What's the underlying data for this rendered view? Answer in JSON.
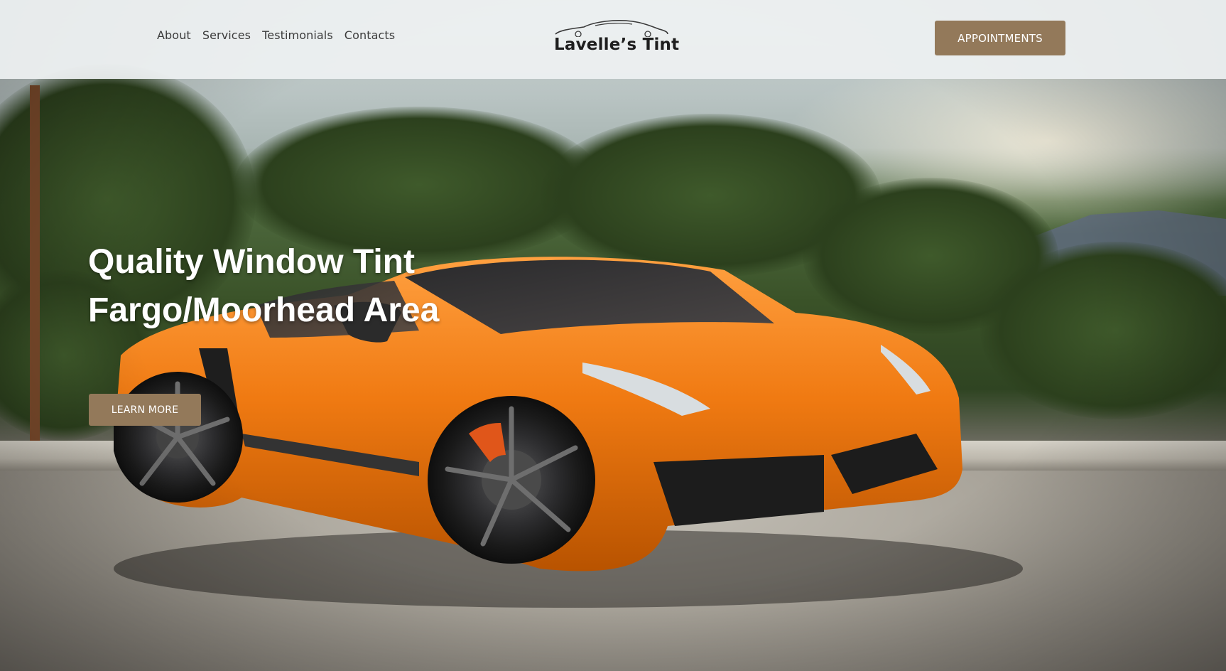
{
  "nav": {
    "items": [
      {
        "label": "About"
      },
      {
        "label": "Services"
      },
      {
        "label": "Testimonials"
      },
      {
        "label": "Contacts"
      }
    ]
  },
  "logo": {
    "text": "Lavelle’s Tint",
    "icon": "car-silhouette-icon"
  },
  "header": {
    "appointments_label": "APPOINTMENTS"
  },
  "hero": {
    "title_line1": "Quality Window Tint",
    "title_line2": "Fargo/Moorhead Area",
    "learn_more_label": "LEARN MORE",
    "image": "orange-sports-car-photo"
  },
  "colors": {
    "button": "#93795a",
    "header_bg": "#eef1f2",
    "car_body": "#f07a12"
  }
}
